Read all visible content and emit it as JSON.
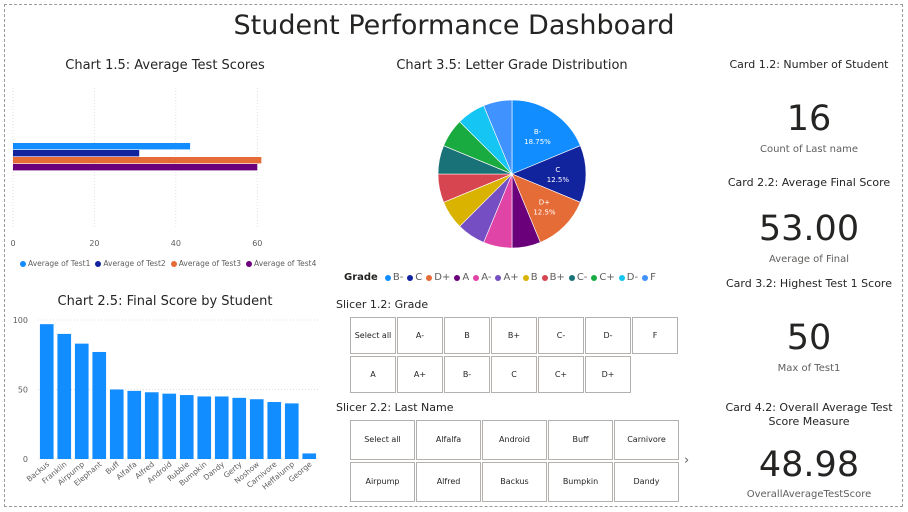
{
  "dashboard_title": "Student Performance Dashboard",
  "chart_1": {
    "title": "Chart 1.5: Average Test Scores",
    "chart_data": {
      "type": "bar",
      "orientation": "horizontal",
      "categories": [
        ""
      ],
      "series": [
        {
          "name": "Average of Test1",
          "values": [
            43.5
          ],
          "color": "#118DFF"
        },
        {
          "name": "Average of Test2",
          "values": [
            31
          ],
          "color": "#12239E"
        },
        {
          "name": "Average of Test3",
          "values": [
            61
          ],
          "color": "#E66C37"
        },
        {
          "name": "Average of Test4",
          "values": [
            60
          ],
          "color": "#6B007B"
        }
      ],
      "xlim": [
        0,
        70
      ],
      "x_ticks": [
        "0",
        "20",
        "40",
        "60"
      ],
      "grid": true,
      "legend": "bottom"
    }
  },
  "chart_2": {
    "title": "Chart 2.5: Final Score by Student",
    "chart_data": {
      "type": "bar",
      "categories": [
        "Backus",
        "Franklin",
        "Airpump",
        "Elephant",
        "Buff",
        "Alfalfa",
        "Alfred",
        "Android",
        "Rubble",
        "Bumpkin",
        "Dandy",
        "Gerty",
        "Noshow",
        "Carnivore",
        "Heffalump",
        "George"
      ],
      "values": [
        97,
        90,
        83,
        77,
        50,
        49,
        48,
        47,
        46,
        45,
        45,
        44,
        43,
        41,
        40,
        4
      ],
      "ylim": [
        0,
        100
      ],
      "y_ticks": [
        "0",
        "50",
        "100"
      ],
      "color": "#118DFF",
      "grid": true
    }
  },
  "chart_3": {
    "title": "Chart 3.5: Letter Grade Distribution",
    "chart_data": {
      "type": "pie",
      "legend_title": "Grade",
      "labels": [
        "B-",
        "C",
        "D+",
        "A",
        "A-",
        "A+",
        "B",
        "B+",
        "C-",
        "C+",
        "D-",
        "F"
      ],
      "values": [
        18.75,
        12.5,
        12.5,
        6.25,
        6.25,
        6.25,
        6.25,
        6.25,
        6.25,
        6.25,
        6.25,
        6.25
      ],
      "colors": [
        "#118DFF",
        "#12239E",
        "#E66C37",
        "#6B007B",
        "#E044A7",
        "#744EC2",
        "#D9B300",
        "#D64550",
        "#197278",
        "#1AAB40",
        "#15C6F4",
        "#4092FF"
      ],
      "data_labels": [
        {
          "label": "B-",
          "value": "18.75%"
        },
        {
          "label": "C",
          "value": "12.5%"
        },
        {
          "label": "D+",
          "value": "12.5%"
        }
      ],
      "legend": "bottom"
    }
  },
  "slicer_grade": {
    "title": "Slicer 1.2: Grade",
    "row1": [
      "Select all",
      "A-",
      "B",
      "B+",
      "C-",
      "D-",
      "F"
    ],
    "row2": [
      "A",
      "A+",
      "B-",
      "C",
      "C+",
      "D+"
    ]
  },
  "slicer_name": {
    "title": "Slicer 2.2: Last Name",
    "row1": [
      "Select all",
      "Alfalfa",
      "Android",
      "Buff",
      "Carnivore"
    ],
    "row2": [
      "Airpump",
      "Alfred",
      "Backus",
      "Bumpkin",
      "Dandy"
    ],
    "more_icon": "chevron-right-icon"
  },
  "cards": [
    {
      "title": "Card 1.2: Number of Student",
      "value": "16",
      "label": "Count of Last name"
    },
    {
      "title": "Card 2.2: Average Final Score",
      "value": "53.00",
      "label": "Average of Final"
    },
    {
      "title": "Card 3.2: Highest Test 1 Score",
      "value": "50",
      "label": "Max of Test1"
    },
    {
      "title": "Card 4.2: Overall Average Test Score Measure",
      "value": "48.98",
      "label": "OverallAverageTestScore"
    }
  ]
}
